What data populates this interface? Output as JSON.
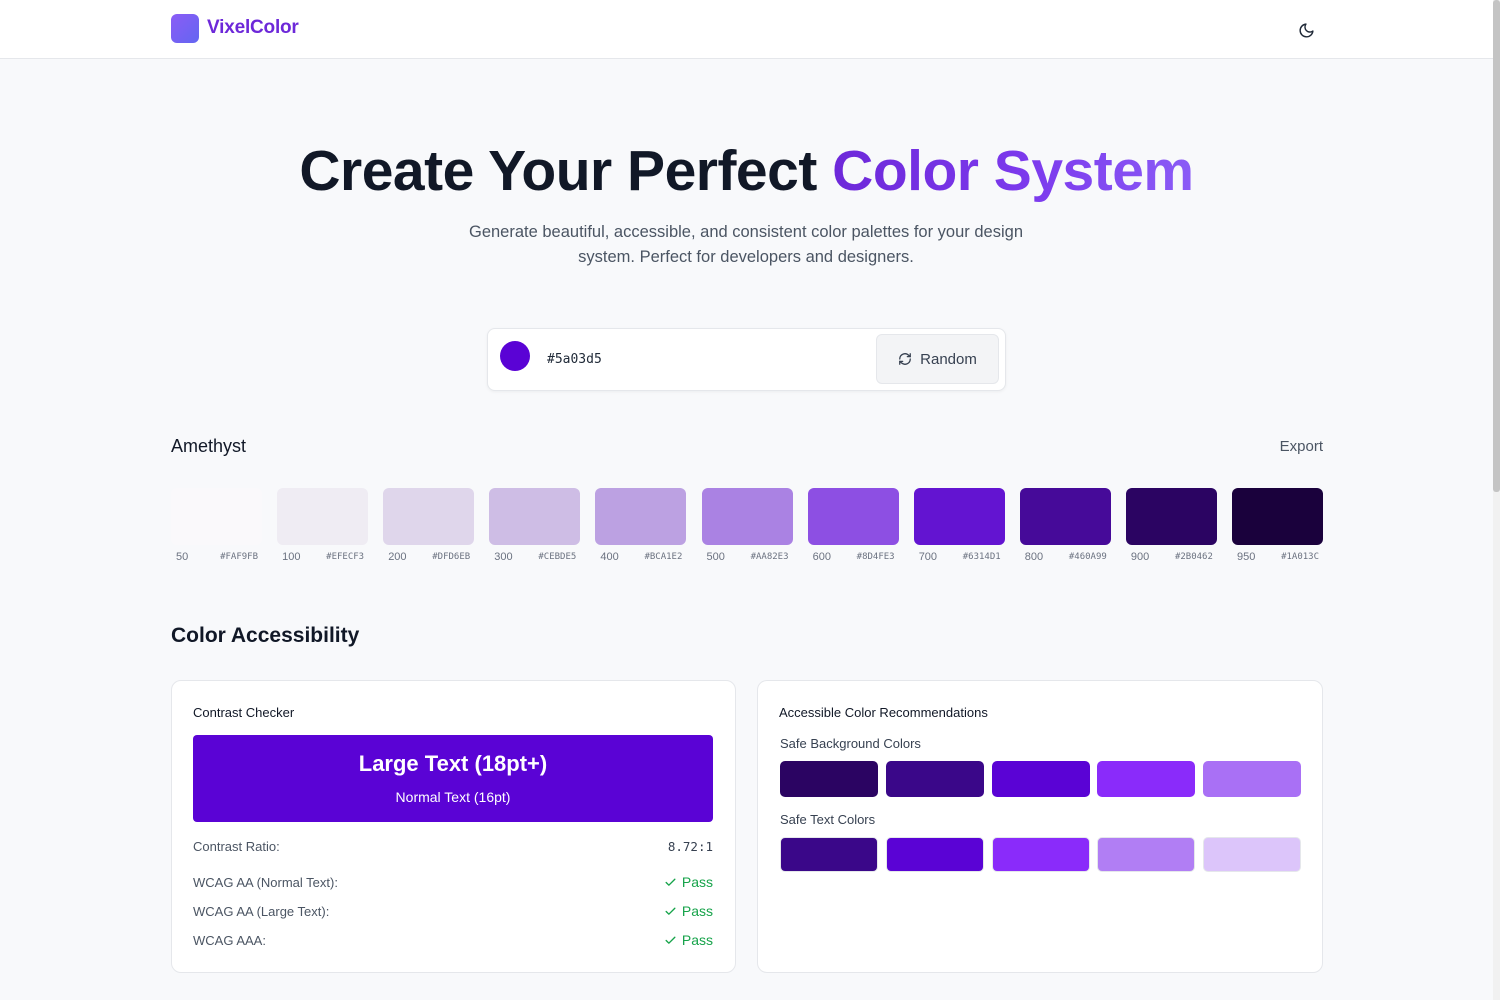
{
  "header": {
    "brand": "VixelColor",
    "theme_toggle_icon": "moon-icon"
  },
  "hero": {
    "title_main": "Create Your Perfect ",
    "title_accent": "Color System",
    "subtitle": "Generate beautiful, accessible, and consistent color palettes for your design system. Perfect for developers and designers."
  },
  "picker": {
    "color": "#5a03d5",
    "value": "#5a03d5",
    "random_label": "Random",
    "random_icon": "refresh-icon"
  },
  "palette": {
    "name": "Amethyst",
    "export_label": "Export",
    "shades": [
      {
        "step": "50",
        "hex": "#FAF9FB"
      },
      {
        "step": "100",
        "hex": "#EFECF3"
      },
      {
        "step": "200",
        "hex": "#DFD6EB"
      },
      {
        "step": "300",
        "hex": "#CEBDE5"
      },
      {
        "step": "400",
        "hex": "#BCA1E2"
      },
      {
        "step": "500",
        "hex": "#AA82E3"
      },
      {
        "step": "600",
        "hex": "#8D4FE3"
      },
      {
        "step": "700",
        "hex": "#6314D1"
      },
      {
        "step": "800",
        "hex": "#460A99"
      },
      {
        "step": "900",
        "hex": "#2B0462"
      },
      {
        "step": "950",
        "hex": "#1A013C"
      }
    ]
  },
  "accessibility": {
    "title": "Color Accessibility",
    "contrast": {
      "title": "Contrast Checker",
      "preview_bg": "#5a03d5",
      "large_text": "Large Text (18pt+)",
      "normal_text": "Normal Text (16pt)",
      "ratio_label": "Contrast Ratio:",
      "ratio_value": "8.72:1",
      "checks": [
        {
          "label": "WCAG AA (Normal Text):",
          "result": "Pass"
        },
        {
          "label": "WCAG AA (Large Text):",
          "result": "Pass"
        },
        {
          "label": "WCAG AAA:",
          "result": "Pass"
        }
      ],
      "pass_color": "#16a34a"
    },
    "recommendations": {
      "title": "Accessible Color Recommendations",
      "background_label": "Safe Background Colors",
      "background_colors": [
        "#2B0462",
        "#3A0789",
        "#5A03D5",
        "#8A2BFA",
        "#A970F5"
      ],
      "text_label": "Safe Text Colors",
      "text_colors": [
        "#3A0789",
        "#5A03D5",
        "#8A2BFA",
        "#B17EF4",
        "#DCC5FA"
      ]
    }
  }
}
